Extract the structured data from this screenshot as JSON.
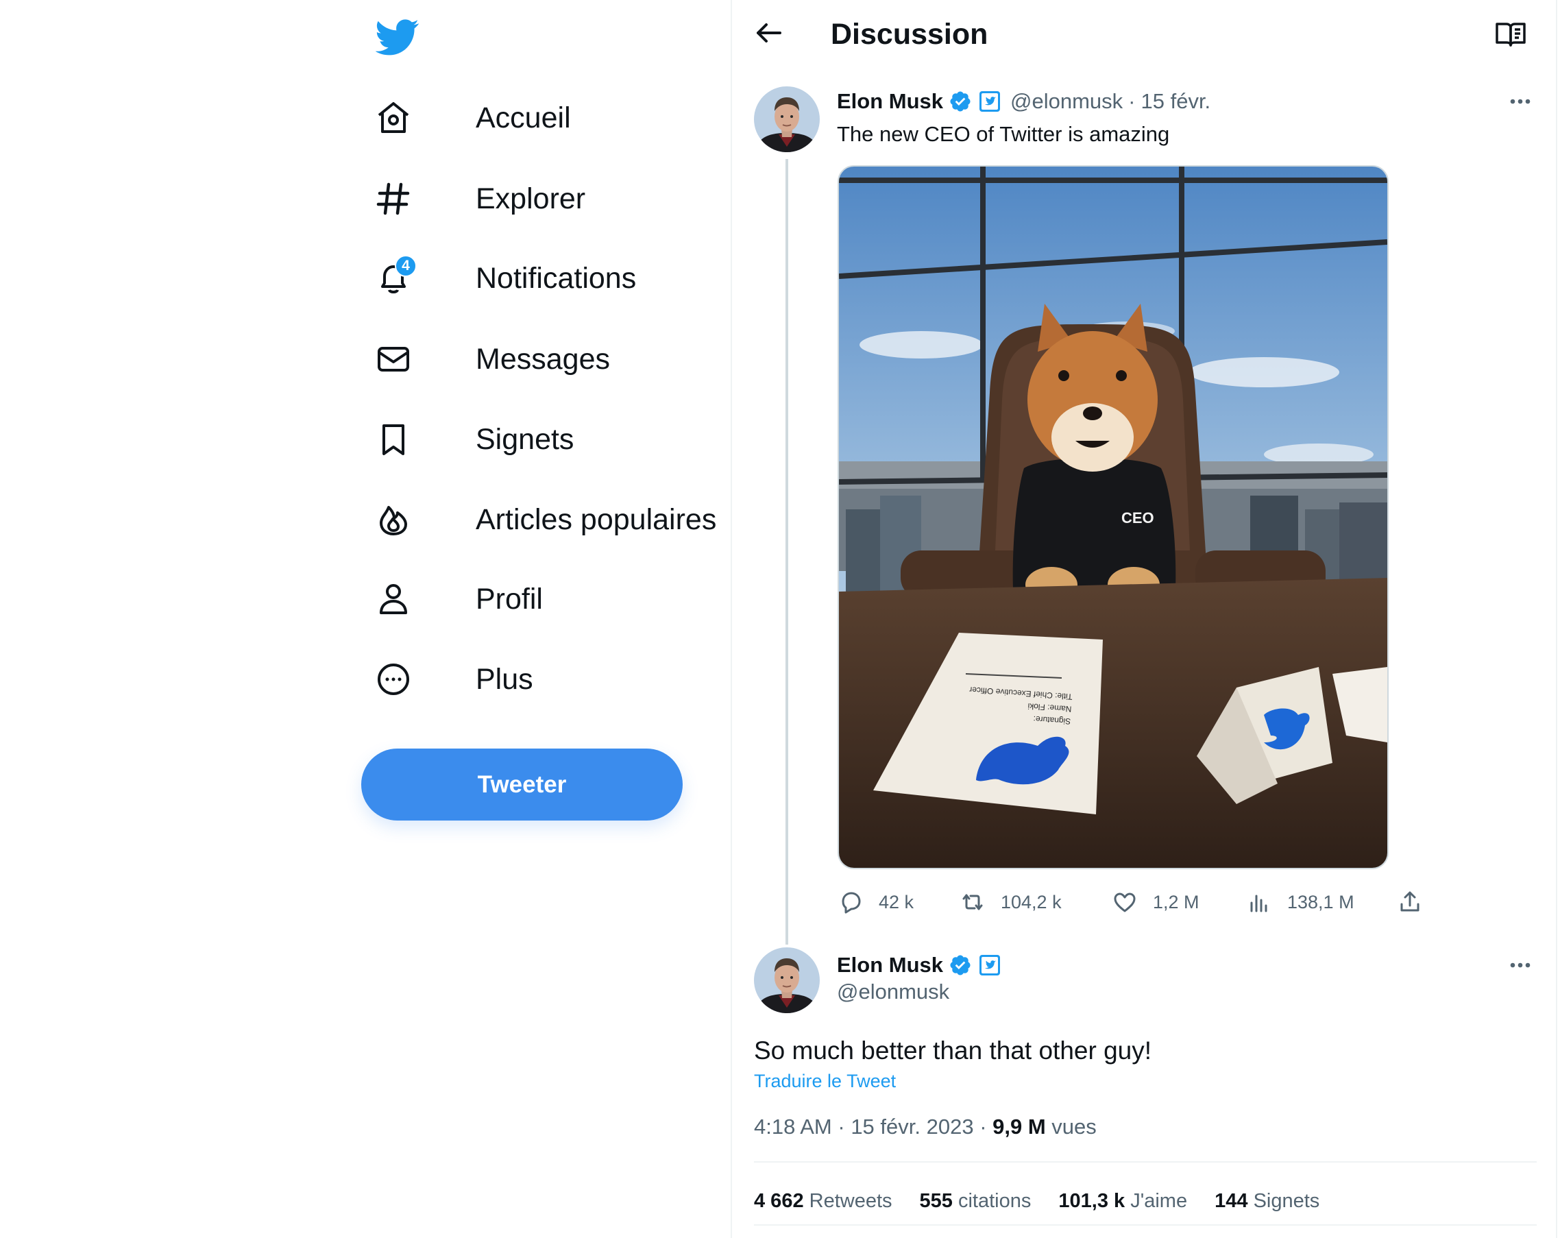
{
  "nav": {
    "items": [
      {
        "label": "Accueil",
        "icon": "home-icon"
      },
      {
        "label": "Explorer",
        "icon": "hashtag-icon"
      },
      {
        "label": "Notifications",
        "icon": "bell-icon",
        "badge": "4"
      },
      {
        "label": "Messages",
        "icon": "envelope-icon"
      },
      {
        "label": "Signets",
        "icon": "bookmark-icon"
      },
      {
        "label": "Articles populaires",
        "icon": "flame-icon"
      },
      {
        "label": "Profil",
        "icon": "person-icon"
      },
      {
        "label": "Plus",
        "icon": "more-circle-icon"
      }
    ],
    "tweet_button": "Tweeter"
  },
  "header": {
    "title": "Discussion"
  },
  "tweet1": {
    "name": "Elon Musk",
    "handle": "@elonmusk",
    "date": "15 févr.",
    "text": "The new CEO of Twitter is amazing",
    "image": {
      "sweater_text": "CEO",
      "paper_lines": [
        "Signature:",
        "Name:  Floki",
        "Title:  Chief Executive Officer"
      ]
    },
    "actions": {
      "replies": "42 k",
      "retweets": "104,2 k",
      "likes": "1,2 M",
      "views": "138,1 M"
    }
  },
  "tweet2": {
    "name": "Elon Musk",
    "handle": "@elonmusk",
    "text": "So much better than that other guy!",
    "translate": "Traduire le Tweet",
    "time": "4:18 AM",
    "date": "15 févr. 2023",
    "views_count": "9,9 M",
    "views_label": "vues",
    "stats": [
      {
        "count": "4 662",
        "label": "Retweets"
      },
      {
        "count": "555",
        "label": "citations"
      },
      {
        "count": "101,3 k",
        "label": "J'aime"
      },
      {
        "count": "144",
        "label": "Signets"
      }
    ]
  },
  "colors": {
    "brand": "#1d9bf0",
    "tweet_button": "#3b8ced",
    "text": "#0f1419",
    "muted": "#536471",
    "border": "#eff3f4"
  }
}
